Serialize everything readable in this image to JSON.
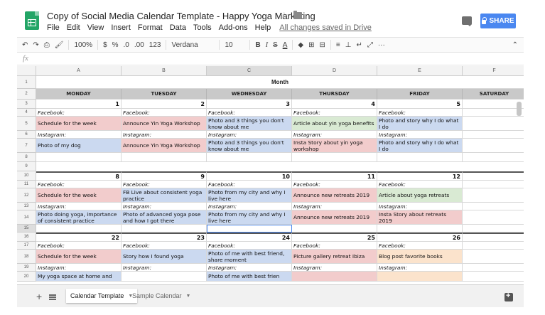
{
  "title_bar": {
    "doc_title": "Copy of Social Media Calendar Template - Happy Yoga Marketing",
    "star_icon": "star-icon",
    "folder_icon": "folder-icon",
    "share_label": "SHARE",
    "comment_icon": "comment-icon"
  },
  "menu": [
    "File",
    "Edit",
    "View",
    "Insert",
    "Format",
    "Data",
    "Tools",
    "Add-ons",
    "Help"
  ],
  "saved_status": "All changes saved in Drive",
  "toolbar": {
    "undo": "↶",
    "redo": "↷",
    "print": "⎙",
    "paint": "🖌",
    "zoom": "100%",
    "currency": "$",
    "percent": "%",
    "dec_less": ".0",
    "dec_more": ".00",
    "number_format": "123",
    "font": "Verdana",
    "size": "10",
    "bold": "B",
    "italic": "I",
    "strike": "S",
    "text_color": "A",
    "fill": "◆",
    "borders": "⊞",
    "merge": "⊟",
    "align": "≡",
    "valign": "⊥",
    "wrap": "↵",
    "rotate": "⤢",
    "more": "···",
    "collapse": "⌃"
  },
  "formula": {
    "fx": "fx"
  },
  "columns": [
    "A",
    "B",
    "C",
    "D",
    "E",
    "F"
  ],
  "row_numbers": [
    "1",
    "2",
    "3",
    "4",
    "5",
    "6",
    "7",
    "8",
    "9",
    "10",
    "11",
    "12",
    "13",
    "14",
    "15",
    "16",
    "17",
    "18",
    "19",
    "20"
  ],
  "month_title": "Month",
  "weekdays": [
    "MONDAY",
    "TUESDAY",
    "WEDNESDAY",
    "THURSDAY",
    "FRIDAY",
    "SATURDAY"
  ],
  "weeks": [
    {
      "days": [
        "1",
        "2",
        "3",
        "4",
        "5"
      ],
      "facebook_label": "Facebook:",
      "facebook": [
        {
          "text": "Schedule for the week",
          "color": "#f2cccc"
        },
        {
          "text": "Announce Yin Yoga Workshop",
          "color": "#f2cccc"
        },
        {
          "text": "Photo and 3 things you don't know about me",
          "color": "#cbd9f0"
        },
        {
          "text": "Article about yin yoga benefits",
          "color": "#d9ead3"
        },
        {
          "text": "Photo and story why I do what I do",
          "color": "#cbd9f0"
        }
      ],
      "instagram_label": "Instagram:",
      "instagram": [
        {
          "text": "Photo of my dog",
          "color": "#cbd9f0"
        },
        {
          "text": "Announce Yin Yoga Workshop",
          "color": "#f2cccc"
        },
        {
          "text": "Photo and 3 things you don't know about me",
          "color": "#cbd9f0"
        },
        {
          "text": "Insta Story about yin yoga workshop",
          "color": "#f2cccc"
        },
        {
          "text": "Photo and story why I do what I do",
          "color": "#cbd9f0"
        }
      ]
    },
    {
      "days": [
        "8",
        "9",
        "10",
        "11",
        "12"
      ],
      "facebook_label": "Facebook:",
      "facebook": [
        {
          "text": "Schedule for the week",
          "color": "#f2cccc"
        },
        {
          "text": "FB Live about consistent yoga practice",
          "color": "#cbd9f0"
        },
        {
          "text": "Photo from my city and why I live here",
          "color": "#cbd9f0"
        },
        {
          "text": "Announce new retreats 2019",
          "color": "#f2cccc"
        },
        {
          "text": "Article about yoga retreats",
          "color": "#d9ead3"
        }
      ],
      "instagram_label": "Instagram:",
      "instagram": [
        {
          "text": "Photo doing yoga, importance of consistent practice",
          "color": "#cbd9f0"
        },
        {
          "text": "Photo of advanced yoga pose and how I got there",
          "color": "#cbd9f0"
        },
        {
          "text": "Photo from my city and why I live here",
          "color": "#cbd9f0"
        },
        {
          "text": "Announce new retreats 2019",
          "color": "#f2cccc"
        },
        {
          "text": "Insta Story about retreats 2019",
          "color": "#f2cccc"
        }
      ]
    },
    {
      "days": [
        "22",
        "23",
        "24",
        "25",
        "26"
      ],
      "facebook_label": "Facebook:",
      "facebook": [
        {
          "text": "Schedule for the week",
          "color": "#f2cccc"
        },
        {
          "text": "Story how I found yoga",
          "color": "#cbd9f0"
        },
        {
          "text": "Photo of me with best friend, share moment",
          "color": "#cbd9f0"
        },
        {
          "text": "Picture gallery retreat Ibiza",
          "color": "#f2cccc"
        },
        {
          "text": "Blog post favorite books",
          "color": "#fbe3cc"
        }
      ],
      "instagram_label": "Instagram:",
      "instagram": [
        {
          "text": "My yoga space at home and",
          "color": "#cbd9f0"
        },
        {
          "text": "",
          "color": "#ffffff"
        },
        {
          "text": "Photo of me with best frien",
          "color": "#cbd9f0"
        },
        {
          "text": "",
          "color": "#f2cccc"
        },
        {
          "text": "",
          "color": "#fbe3cc"
        }
      ]
    }
  ],
  "sheet_tabs": {
    "add_sheet": "+",
    "active": "Calendar Template",
    "inactive": "Sample Calendar"
  }
}
